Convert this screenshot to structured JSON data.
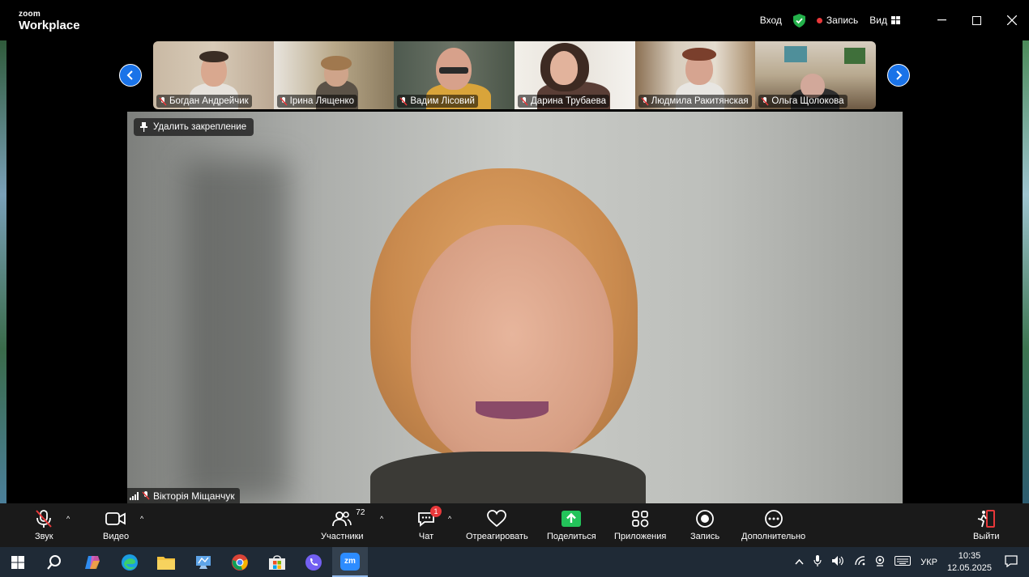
{
  "app": {
    "logo_small": "zoom",
    "logo_big": "Workplace",
    "login": "Вход",
    "record": "Запись",
    "view": "Вид",
    "accent": "#1a73e8"
  },
  "strip": {
    "thumbnails": [
      {
        "name": "Богдан Андрейчик"
      },
      {
        "name": "Ірина Лященко"
      },
      {
        "name": "Вадим Лісовий"
      },
      {
        "name": "Дарина Трубаева"
      },
      {
        "name": "Людмила Ракитянская"
      },
      {
        "name": "Ольга Щолокова"
      }
    ]
  },
  "main": {
    "unpin_label": "Удалить закрепление",
    "speaker_name": "Вікторія Міщанчук"
  },
  "toolbar": {
    "audio": "Звук",
    "video": "Видео",
    "participants": "Участники",
    "participants_count": "72",
    "chat": "Чат",
    "chat_badge": "1",
    "react": "Отреагировать",
    "share": "Поделиться",
    "apps": "Приложения",
    "record": "Запись",
    "more": "Дополнительно",
    "leave": "Выйти"
  },
  "taskbar": {
    "lang": "УКР",
    "time": "10:35",
    "date": "12.05.2025",
    "zoom_label": "zm"
  }
}
